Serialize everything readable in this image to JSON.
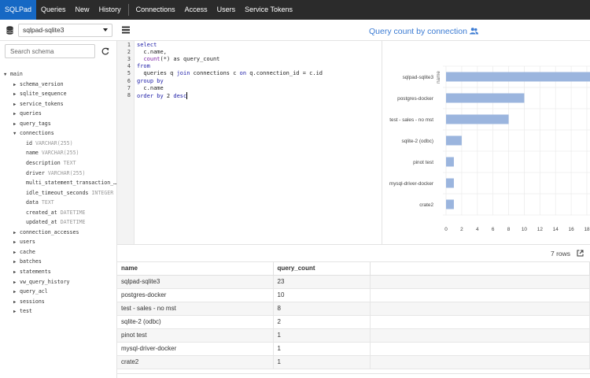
{
  "nav": {
    "brand": "SQLPad",
    "items": [
      "Queries",
      "New",
      "History"
    ],
    "items2": [
      "Connections",
      "Access",
      "Users",
      "Service Tokens"
    ]
  },
  "toolbar": {
    "connection": "sqlpad-sqlite3"
  },
  "chart_title": "Query count by connection",
  "schema": {
    "search_placeholder": "Search schema",
    "tree": [
      {
        "label": "main",
        "type": "",
        "state": "open",
        "indent": 0
      },
      {
        "label": "schema_version",
        "type": "",
        "state": "closed",
        "indent": 1
      },
      {
        "label": "sqlite_sequence",
        "type": "",
        "state": "closed",
        "indent": 1
      },
      {
        "label": "service_tokens",
        "type": "",
        "state": "closed",
        "indent": 1
      },
      {
        "label": "queries",
        "type": "",
        "state": "closed",
        "indent": 1
      },
      {
        "label": "query_tags",
        "type": "",
        "state": "closed",
        "indent": 1
      },
      {
        "label": "connections",
        "type": "",
        "state": "open",
        "indent": 1
      },
      {
        "label": "id",
        "type": "VARCHAR(255)",
        "state": "leaf",
        "indent": 2
      },
      {
        "label": "name",
        "type": "VARCHAR(255)",
        "state": "leaf",
        "indent": 2
      },
      {
        "label": "description",
        "type": "TEXT",
        "state": "leaf",
        "indent": 2
      },
      {
        "label": "driver",
        "type": "VARCHAR(255)",
        "state": "leaf",
        "indent": 2
      },
      {
        "label": "multi_statement_transaction_…",
        "type": "",
        "state": "leaf",
        "indent": 2
      },
      {
        "label": "idle_timeout_seconds",
        "type": "INTEGER",
        "state": "leaf",
        "indent": 2
      },
      {
        "label": "data",
        "type": "TEXT",
        "state": "leaf",
        "indent": 2
      },
      {
        "label": "created_at",
        "type": "DATETIME",
        "state": "leaf",
        "indent": 2
      },
      {
        "label": "updated_at",
        "type": "DATETIME",
        "state": "leaf",
        "indent": 2
      },
      {
        "label": "connection_accesses",
        "type": "",
        "state": "closed",
        "indent": 1
      },
      {
        "label": "users",
        "type": "",
        "state": "closed",
        "indent": 1
      },
      {
        "label": "cache",
        "type": "",
        "state": "closed",
        "indent": 1
      },
      {
        "label": "batches",
        "type": "",
        "state": "closed",
        "indent": 1
      },
      {
        "label": "statements",
        "type": "",
        "state": "closed",
        "indent": 1
      },
      {
        "label": "vw_query_history",
        "type": "",
        "state": "closed",
        "indent": 1
      },
      {
        "label": "query_acl",
        "type": "",
        "state": "closed",
        "indent": 1
      },
      {
        "label": "sessions",
        "type": "",
        "state": "closed",
        "indent": 1
      },
      {
        "label": "test",
        "type": "",
        "state": "closed",
        "indent": 1
      }
    ]
  },
  "editor": {
    "lines": [
      [
        [
          "kw",
          "select"
        ]
      ],
      [
        [
          "",
          "  c.name,"
        ]
      ],
      [
        [
          "",
          "  "
        ],
        [
          "fn",
          "count"
        ],
        [
          "",
          "(*) as query_count"
        ]
      ],
      [
        [
          "kw",
          "from"
        ]
      ],
      [
        [
          "",
          "  queries q "
        ],
        [
          "kw",
          "join"
        ],
        [
          "",
          " connections c "
        ],
        [
          "kw",
          "on"
        ],
        [
          "",
          " q.connection_id = c.id"
        ]
      ],
      [
        [
          "kw",
          "group by"
        ]
      ],
      [
        [
          "",
          "  c.name"
        ]
      ],
      [
        [
          "kw",
          "order by"
        ],
        [
          "",
          " 2 "
        ],
        [
          "kw",
          "desc"
        ]
      ]
    ]
  },
  "chart_data": {
    "type": "bar",
    "orientation": "horizontal",
    "title": "Query count by connection",
    "categories": [
      "sqlpad-sqlite3",
      "postgres-docker",
      "test - sales - no mst",
      "sqlite-2 (odbc)",
      "pinot test",
      "mysql-driver-docker",
      "crate2"
    ],
    "values": [
      23,
      10,
      8,
      2,
      1,
      1,
      1
    ],
    "ylabel": "name",
    "xticks": [
      0,
      2,
      4,
      6,
      8,
      10,
      12,
      14,
      16,
      18
    ],
    "xlim": [
      0,
      18
    ],
    "bar_color": "#9bb5de",
    "grid": true
  },
  "results": {
    "row_count": "7 rows",
    "columns": [
      "name",
      "query_count"
    ],
    "rows": [
      [
        "sqlpad-sqlite3",
        "23"
      ],
      [
        "postgres-docker",
        "10"
      ],
      [
        "test - sales - no mst",
        "8"
      ],
      [
        "sqlite-2 (odbc)",
        "2"
      ],
      [
        "pinot test",
        "1"
      ],
      [
        "mysql-driver-docker",
        "1"
      ],
      [
        "crate2",
        "1"
      ]
    ]
  }
}
